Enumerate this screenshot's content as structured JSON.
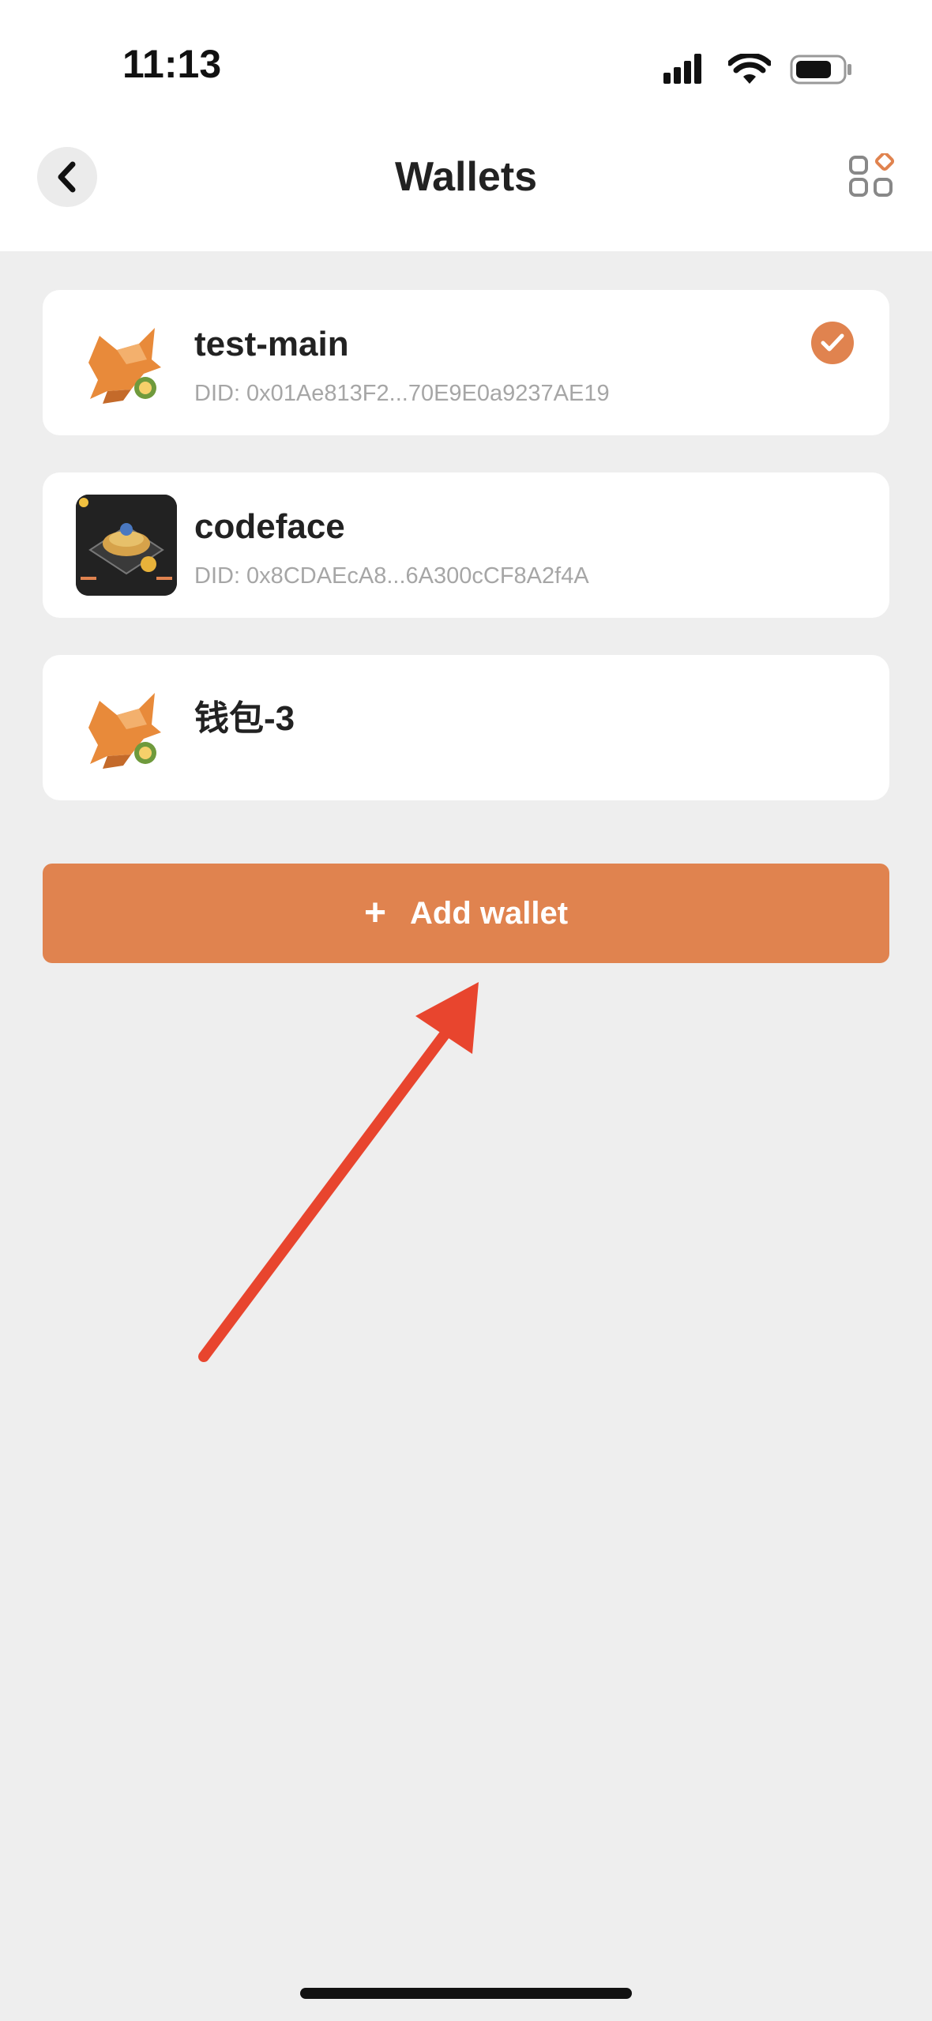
{
  "status_bar": {
    "time": "11:13"
  },
  "header": {
    "title": "Wallets"
  },
  "wallets": [
    {
      "name": "test-main",
      "did": "DID: 0x01Ae813F2...70E9E0a9237AE19",
      "selected": true,
      "avatar_icon": "fox-logo-icon"
    },
    {
      "name": "codeface",
      "did": "DID: 0x8CDAEcA8...6A300cCF8A2f4A",
      "selected": false,
      "avatar_icon": "nft-avatar-image"
    },
    {
      "name": "钱包-3",
      "did": "",
      "selected": false,
      "avatar_icon": "fox-logo-icon"
    }
  ],
  "actions": {
    "add_wallet_label": "Add wallet",
    "plus_symbol": "+"
  },
  "colors": {
    "accent": "#e0834f",
    "annotation_arrow": "#e8452e",
    "background": "#eeeeee"
  }
}
